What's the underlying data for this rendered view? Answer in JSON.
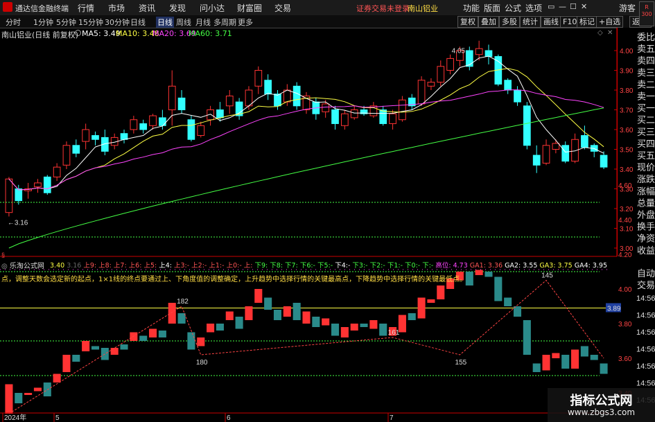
{
  "titlebar": {
    "app_name": "通达信金融终端",
    "menus": [
      "行情",
      "市场",
      "资讯",
      "发现",
      "问小达",
      "财富圈",
      "交易"
    ],
    "notice": "证券交易未登录",
    "stock_name": "南山铝业",
    "right_menus": [
      "功能",
      "版面",
      "公式",
      "选项"
    ],
    "user": "游客",
    "window_buttons": [
      "▭",
      "—",
      "☐",
      "✕"
    ]
  },
  "period_tabs": [
    "分时",
    "1分钟",
    "5分钟",
    "15分钟",
    "30分钟",
    "日线",
    "周线",
    "月线",
    "多周期",
    "更多"
  ],
  "active_period": "日线",
  "toolbar_buttons": [
    "复权",
    "叠加",
    "多股",
    "统计",
    "画线",
    "F10",
    "标记",
    "+自选",
    "返回"
  ],
  "badge": {
    "top": "R",
    "bottom": "300"
  },
  "chart_header": {
    "title": "南山铝业(日线 前复权)",
    "ma": [
      {
        "label": "MA5: 3.49",
        "color": "#ffffff"
      },
      {
        "label": "MA10: 3.48",
        "color": "#ffff44"
      },
      {
        "label": "MA20: 3.69",
        "color": "#ff44ff"
      },
      {
        "label": "MA60: 3.71",
        "color": "#44ff44"
      }
    ]
  },
  "right_panel": [
    "委比",
    "卖五",
    "卖四",
    "卖三",
    "卖二",
    "卖一",
    "买一",
    "买二",
    "买三",
    "买四",
    "买五",
    "现价",
    "涨跌",
    "涨幅",
    "总量",
    "外盘",
    "换手",
    "净资",
    "收益",
    "自动",
    "交易"
  ],
  "chart_data": [
    {
      "type": "candlestick",
      "title": "南山铝业(日线 前复权)",
      "ylim": [
        3.0,
        4.05
      ],
      "yticks": [
        "4.00",
        "3.90",
        "3.80",
        "3.70",
        "3.60",
        "3.50",
        "3.40",
        "3.30",
        "3.20",
        "3.10",
        "3.00"
      ],
      "annotations": [
        {
          "text": "4.05",
          "x_index": 46
        },
        {
          "text": "←3.16",
          "x_index": 0
        }
      ],
      "candles": [
        [
          3.18,
          3.35,
          3.16,
          3.36
        ],
        [
          3.3,
          3.24,
          3.22,
          3.32
        ],
        [
          3.29,
          3.3,
          3.25,
          3.33
        ],
        [
          3.31,
          3.33,
          3.28,
          3.35
        ],
        [
          3.36,
          3.28,
          3.27,
          3.37
        ],
        [
          3.36,
          3.41,
          3.34,
          3.43
        ],
        [
          3.42,
          3.52,
          3.4,
          3.54
        ],
        [
          3.52,
          3.48,
          3.46,
          3.55
        ],
        [
          3.54,
          3.6,
          3.5,
          3.63
        ],
        [
          3.57,
          3.55,
          3.52,
          3.59
        ],
        [
          3.56,
          3.49,
          3.47,
          3.6
        ],
        [
          3.52,
          3.56,
          3.5,
          3.58
        ],
        [
          3.58,
          3.55,
          3.53,
          3.6
        ],
        [
          3.6,
          3.65,
          3.58,
          3.67
        ],
        [
          3.63,
          3.6,
          3.58,
          3.65
        ],
        [
          3.62,
          3.67,
          3.6,
          3.68
        ],
        [
          3.66,
          3.62,
          3.6,
          3.7
        ],
        [
          3.7,
          3.82,
          3.62,
          3.9
        ],
        [
          3.76,
          3.7,
          3.68,
          3.8
        ],
        [
          3.65,
          3.55,
          3.54,
          3.67
        ],
        [
          3.57,
          3.62,
          3.56,
          3.64
        ],
        [
          3.65,
          3.7,
          3.62,
          3.72
        ],
        [
          3.7,
          3.66,
          3.64,
          3.74
        ],
        [
          3.72,
          3.77,
          3.68,
          3.8
        ],
        [
          3.74,
          3.67,
          3.65,
          3.76
        ],
        [
          3.72,
          3.8,
          3.7,
          3.82
        ],
        [
          3.82,
          3.9,
          3.78,
          3.92
        ],
        [
          3.85,
          3.78,
          3.75,
          3.88
        ],
        [
          3.78,
          3.72,
          3.7,
          3.8
        ],
        [
          3.74,
          3.8,
          3.72,
          3.83
        ],
        [
          3.82,
          3.72,
          3.7,
          3.84
        ],
        [
          3.7,
          3.77,
          3.68,
          3.79
        ],
        [
          3.74,
          3.68,
          3.65,
          3.76
        ],
        [
          3.69,
          3.73,
          3.66,
          3.75
        ],
        [
          3.7,
          3.63,
          3.6,
          3.72
        ],
        [
          3.62,
          3.68,
          3.6,
          3.7
        ],
        [
          3.66,
          3.7,
          3.65,
          3.72
        ],
        [
          3.7,
          3.68,
          3.67,
          3.72
        ],
        [
          3.67,
          3.72,
          3.66,
          3.74
        ],
        [
          3.7,
          3.63,
          3.62,
          3.72
        ],
        [
          3.63,
          3.68,
          3.6,
          3.7
        ],
        [
          3.65,
          3.75,
          3.64,
          3.77
        ],
        [
          3.76,
          3.72,
          3.7,
          3.78
        ],
        [
          3.73,
          3.85,
          3.72,
          3.87
        ],
        [
          3.82,
          3.84,
          3.8,
          3.86
        ],
        [
          3.84,
          3.92,
          3.82,
          3.95
        ],
        [
          3.9,
          3.96,
          3.88,
          3.98
        ],
        [
          3.95,
          4.0,
          3.92,
          4.02
        ],
        [
          4.0,
          3.92,
          3.9,
          4.02
        ],
        [
          3.98,
          4.01,
          3.95,
          4.05
        ],
        [
          4.0,
          3.97,
          3.93,
          4.03
        ],
        [
          3.97,
          3.83,
          3.82,
          3.98
        ],
        [
          3.85,
          3.8,
          3.78,
          3.86
        ],
        [
          3.8,
          3.74,
          3.72,
          3.82
        ],
        [
          3.72,
          3.52,
          3.5,
          3.74
        ],
        [
          3.47,
          3.42,
          3.38,
          3.52
        ],
        [
          3.43,
          3.52,
          3.42,
          3.55
        ],
        [
          3.5,
          3.53,
          3.48,
          3.55
        ],
        [
          3.52,
          3.44,
          3.43,
          3.54
        ],
        [
          3.44,
          3.55,
          3.43,
          3.58
        ],
        [
          3.57,
          3.51,
          3.5,
          3.62
        ],
        [
          3.52,
          3.49,
          3.46,
          3.53
        ],
        [
          3.47,
          3.41,
          3.4,
          3.49
        ]
      ]
    },
    {
      "type": "line",
      "title": "乐淘公式网",
      "ylim": [
        3.3,
        4.7
      ],
      "yticks": [
        "4.60",
        "4.40",
        "4.20",
        "4.00",
        "3.80",
        "3.60",
        "3.40"
      ],
      "legend": [
        {
          "text": "3.40",
          "color": "#ffff44"
        },
        {
          "text": "3.16",
          "color": "#666666"
        },
        {
          "text": "上9:",
          "color": "#ff5555"
        },
        {
          "text": "上8:",
          "color": "#ff5555"
        },
        {
          "text": "上7:",
          "color": "#ff5555"
        },
        {
          "text": "上6:",
          "color": "#ff5555"
        },
        {
          "text": "上5:",
          "color": "#ff5555"
        },
        {
          "text": "上4:",
          "color": "#ffffff"
        },
        {
          "text": "上3:-",
          "color": "#ff5555"
        },
        {
          "text": "上2:-",
          "color": "#ff5555"
        },
        {
          "text": "上1:-",
          "color": "#ff5555"
        },
        {
          "text": "上0:-",
          "color": "#ff5555"
        },
        {
          "text": "上:",
          "color": "#ff5555"
        },
        {
          "text": "下9:",
          "color": "#44ff44"
        },
        {
          "text": "下8:",
          "color": "#44ff44"
        },
        {
          "text": "下7:",
          "color": "#44ff44"
        },
        {
          "text": "下6:-",
          "color": "#44ff44"
        },
        {
          "text": "下5:-",
          "color": "#44ff44"
        },
        {
          "text": "下4:-",
          "color": "#ffffff"
        },
        {
          "text": "下3:-",
          "color": "#44ff44"
        },
        {
          "text": "下2:-",
          "color": "#44ff44"
        },
        {
          "text": "下1:-",
          "color": "#44ff44"
        },
        {
          "text": "下0:-",
          "color": "#44ff44"
        },
        {
          "text": "下:-",
          "color": "#44ff44"
        },
        {
          "text": "高位: 4.73",
          "color": "#ff44ff"
        },
        {
          "text": "GA1: 3.36",
          "color": "#ff5555"
        },
        {
          "text": "GA2: 3.55",
          "color": "#ffffff"
        },
        {
          "text": "GA3: 3.75",
          "color": "#ffff44"
        },
        {
          "text": "GA4: 3.95",
          "color": "#ffffff"
        }
      ],
      "description": "点，调整天数会选定新的起点，1×1线的终点要通过上、下角度值的调整确定，上升趋势中选择行情的关键最高点，下降趋势中选择行情的关键最低点。",
      "wave_labels": [
        {
          "text": "182",
          "x_index": 18
        },
        {
          "text": "180",
          "x_index": 20
        },
        {
          "text": "161",
          "x_index": 40
        },
        {
          "text": "155",
          "x_index": 47
        },
        {
          "text": "145",
          "x_index": 56
        }
      ],
      "level_label": "3.89",
      "x_labels": [
        "2024年",
        "5",
        "6",
        "7"
      ]
    }
  ],
  "time_labels": [
    "14:56",
    "14:56",
    "14:56",
    "14:56",
    "14:56",
    "14:56",
    "14:56"
  ],
  "badge_text": "指标公式网",
  "watermark": {
    "title": "指标公式网",
    "url": "www.zbgs3.com"
  },
  "colors": {
    "up": "#ff3333",
    "down": "#33ffff",
    "ma5": "#ffffff",
    "ma10": "#ffff44",
    "ma20": "#ff44ff",
    "ma60": "#44ff44"
  }
}
